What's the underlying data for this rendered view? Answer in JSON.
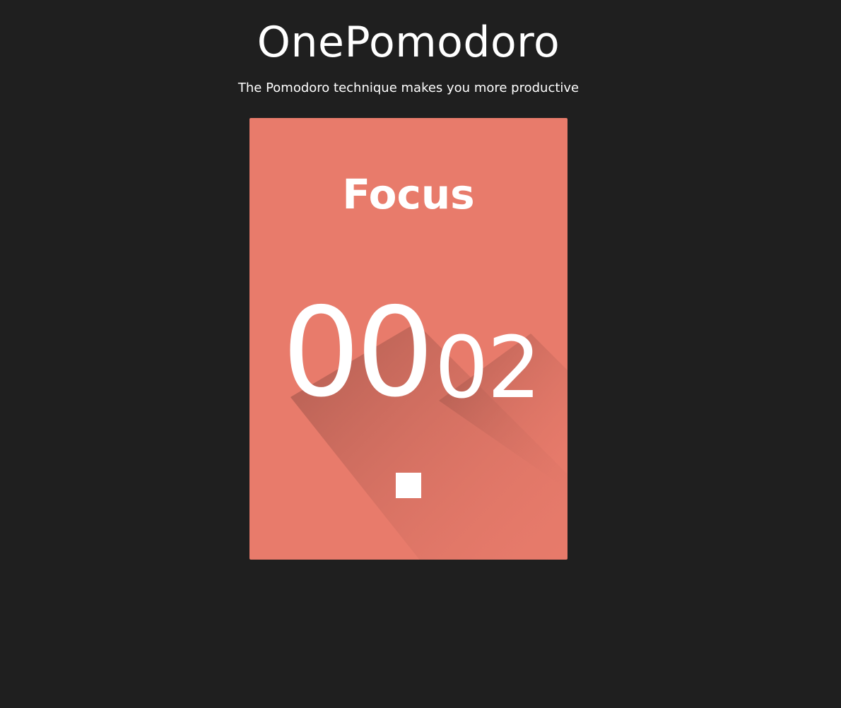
{
  "app": {
    "title": "OnePomodoro",
    "subtitle": "The Pomodoro technique makes you more productive"
  },
  "timer": {
    "mode": "Focus",
    "minutes": "00",
    "seconds": "02",
    "card_color": "#e87b6b",
    "shadow_color": "#a85a4f",
    "background_color": "#1f1f1f"
  },
  "controls": {
    "stop_icon": "stop-icon"
  }
}
